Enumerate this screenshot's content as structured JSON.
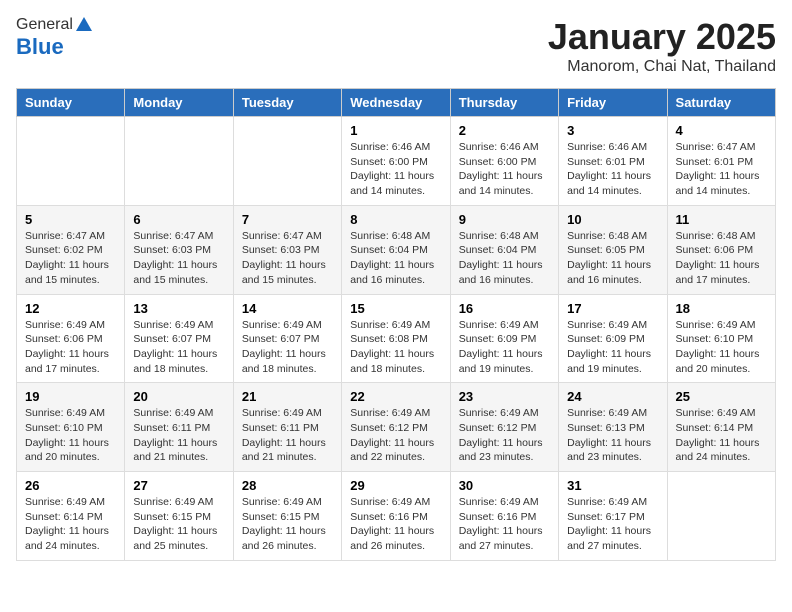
{
  "header": {
    "logo_general": "General",
    "logo_blue": "Blue",
    "month_title": "January 2025",
    "location": "Manorom, Chai Nat, Thailand"
  },
  "weekdays": [
    "Sunday",
    "Monday",
    "Tuesday",
    "Wednesday",
    "Thursday",
    "Friday",
    "Saturday"
  ],
  "weeks": [
    [
      {
        "day": "",
        "info": ""
      },
      {
        "day": "",
        "info": ""
      },
      {
        "day": "",
        "info": ""
      },
      {
        "day": "1",
        "info": "Sunrise: 6:46 AM\nSunset: 6:00 PM\nDaylight: 11 hours and 14 minutes."
      },
      {
        "day": "2",
        "info": "Sunrise: 6:46 AM\nSunset: 6:00 PM\nDaylight: 11 hours and 14 minutes."
      },
      {
        "day": "3",
        "info": "Sunrise: 6:46 AM\nSunset: 6:01 PM\nDaylight: 11 hours and 14 minutes."
      },
      {
        "day": "4",
        "info": "Sunrise: 6:47 AM\nSunset: 6:01 PM\nDaylight: 11 hours and 14 minutes."
      }
    ],
    [
      {
        "day": "5",
        "info": "Sunrise: 6:47 AM\nSunset: 6:02 PM\nDaylight: 11 hours and 15 minutes."
      },
      {
        "day": "6",
        "info": "Sunrise: 6:47 AM\nSunset: 6:03 PM\nDaylight: 11 hours and 15 minutes."
      },
      {
        "day": "7",
        "info": "Sunrise: 6:47 AM\nSunset: 6:03 PM\nDaylight: 11 hours and 15 minutes."
      },
      {
        "day": "8",
        "info": "Sunrise: 6:48 AM\nSunset: 6:04 PM\nDaylight: 11 hours and 16 minutes."
      },
      {
        "day": "9",
        "info": "Sunrise: 6:48 AM\nSunset: 6:04 PM\nDaylight: 11 hours and 16 minutes."
      },
      {
        "day": "10",
        "info": "Sunrise: 6:48 AM\nSunset: 6:05 PM\nDaylight: 11 hours and 16 minutes."
      },
      {
        "day": "11",
        "info": "Sunrise: 6:48 AM\nSunset: 6:06 PM\nDaylight: 11 hours and 17 minutes."
      }
    ],
    [
      {
        "day": "12",
        "info": "Sunrise: 6:49 AM\nSunset: 6:06 PM\nDaylight: 11 hours and 17 minutes."
      },
      {
        "day": "13",
        "info": "Sunrise: 6:49 AM\nSunset: 6:07 PM\nDaylight: 11 hours and 18 minutes."
      },
      {
        "day": "14",
        "info": "Sunrise: 6:49 AM\nSunset: 6:07 PM\nDaylight: 11 hours and 18 minutes."
      },
      {
        "day": "15",
        "info": "Sunrise: 6:49 AM\nSunset: 6:08 PM\nDaylight: 11 hours and 18 minutes."
      },
      {
        "day": "16",
        "info": "Sunrise: 6:49 AM\nSunset: 6:09 PM\nDaylight: 11 hours and 19 minutes."
      },
      {
        "day": "17",
        "info": "Sunrise: 6:49 AM\nSunset: 6:09 PM\nDaylight: 11 hours and 19 minutes."
      },
      {
        "day": "18",
        "info": "Sunrise: 6:49 AM\nSunset: 6:10 PM\nDaylight: 11 hours and 20 minutes."
      }
    ],
    [
      {
        "day": "19",
        "info": "Sunrise: 6:49 AM\nSunset: 6:10 PM\nDaylight: 11 hours and 20 minutes."
      },
      {
        "day": "20",
        "info": "Sunrise: 6:49 AM\nSunset: 6:11 PM\nDaylight: 11 hours and 21 minutes."
      },
      {
        "day": "21",
        "info": "Sunrise: 6:49 AM\nSunset: 6:11 PM\nDaylight: 11 hours and 21 minutes."
      },
      {
        "day": "22",
        "info": "Sunrise: 6:49 AM\nSunset: 6:12 PM\nDaylight: 11 hours and 22 minutes."
      },
      {
        "day": "23",
        "info": "Sunrise: 6:49 AM\nSunset: 6:12 PM\nDaylight: 11 hours and 23 minutes."
      },
      {
        "day": "24",
        "info": "Sunrise: 6:49 AM\nSunset: 6:13 PM\nDaylight: 11 hours and 23 minutes."
      },
      {
        "day": "25",
        "info": "Sunrise: 6:49 AM\nSunset: 6:14 PM\nDaylight: 11 hours and 24 minutes."
      }
    ],
    [
      {
        "day": "26",
        "info": "Sunrise: 6:49 AM\nSunset: 6:14 PM\nDaylight: 11 hours and 24 minutes."
      },
      {
        "day": "27",
        "info": "Sunrise: 6:49 AM\nSunset: 6:15 PM\nDaylight: 11 hours and 25 minutes."
      },
      {
        "day": "28",
        "info": "Sunrise: 6:49 AM\nSunset: 6:15 PM\nDaylight: 11 hours and 26 minutes."
      },
      {
        "day": "29",
        "info": "Sunrise: 6:49 AM\nSunset: 6:16 PM\nDaylight: 11 hours and 26 minutes."
      },
      {
        "day": "30",
        "info": "Sunrise: 6:49 AM\nSunset: 6:16 PM\nDaylight: 11 hours and 27 minutes."
      },
      {
        "day": "31",
        "info": "Sunrise: 6:49 AM\nSunset: 6:17 PM\nDaylight: 11 hours and 27 minutes."
      },
      {
        "day": "",
        "info": ""
      }
    ]
  ]
}
